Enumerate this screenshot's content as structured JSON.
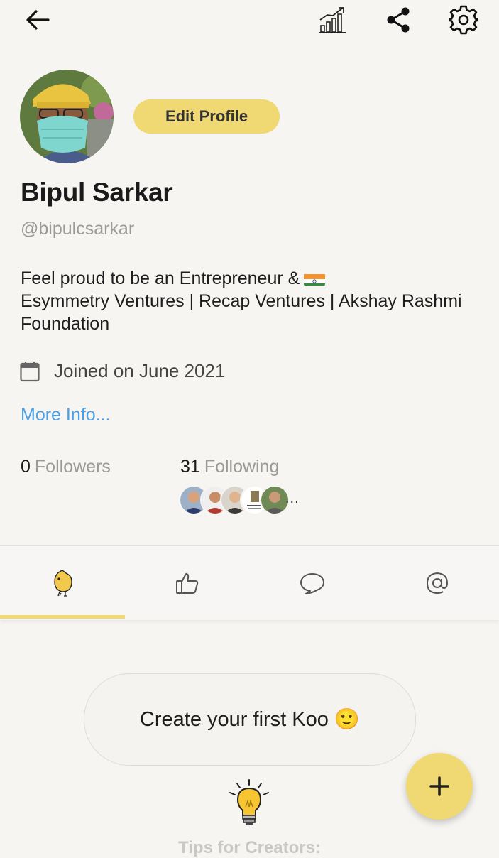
{
  "header": {
    "back_icon": "arrow-left-icon",
    "stats_icon": "bar-chart-trend-icon",
    "share_icon": "share-icon",
    "settings_icon": "gear-icon"
  },
  "profile": {
    "edit_label": "Edit Profile",
    "name": "Bipul Sarkar",
    "handle": "@bipulcsarkar",
    "bio_line1": "Feel proud to be an Entrepreneur &",
    "bio_rest": "Esymmetry Ventures | Recap Ventures | Akshay Rashmi Foundation",
    "joined": "Joined on June 2021",
    "more_info": "More Info...",
    "followers_count": "0",
    "followers_label": "Followers",
    "following_count": "31",
    "following_label": "Following",
    "following_more": "..."
  },
  "tabs": [
    {
      "name": "koos",
      "icon": "koo-bird-icon",
      "active": true
    },
    {
      "name": "likes",
      "icon": "thumbs-up-icon"
    },
    {
      "name": "comments",
      "icon": "comment-bubble-icon"
    },
    {
      "name": "mentions",
      "icon": "at-sign-icon"
    }
  ],
  "empty_state": {
    "create_label": "Create your first Koo 🙂",
    "tips_label": "Tips for Creators:"
  },
  "fab": {
    "icon": "plus-icon"
  },
  "colors": {
    "accent_yellow": "#f0d873",
    "link_blue": "#4a9fe8",
    "muted_gray": "#9a9a9a",
    "background": "#f6f5f2"
  }
}
